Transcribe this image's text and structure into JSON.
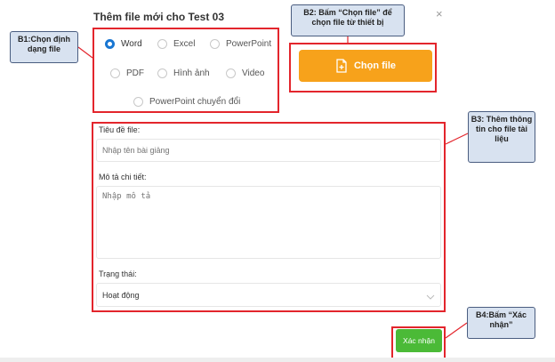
{
  "modal": {
    "title": "Thêm file mới cho Test 03",
    "close": "×"
  },
  "file_types": {
    "options": [
      {
        "label": "Word",
        "checked": true
      },
      {
        "label": "Excel",
        "checked": false
      },
      {
        "label": "PowerPoint",
        "checked": false
      },
      {
        "label": "PDF",
        "checked": false
      },
      {
        "label": "Hình ảnh",
        "checked": false
      },
      {
        "label": "Video",
        "checked": false
      },
      {
        "label": "PowerPoint chuyển đổi",
        "checked": false
      }
    ]
  },
  "upload": {
    "label": "Chọn file",
    "icon": "file-add-icon",
    "color": "#f7a21b"
  },
  "form": {
    "title_label": "Tiêu đề file:",
    "title_placeholder": "Nhập tên bài giảng",
    "desc_label": "Mô tả chi tiết:",
    "desc_placeholder": "Nhập mô tả",
    "status_label": "Trạng thái:",
    "status_value": "Hoạt động"
  },
  "confirm": {
    "label": "Xác nhận",
    "color": "#4bba37"
  },
  "annotations": {
    "b1": "B1:Chọn định dạng file",
    "b2": "B2: Bấm “Chọn file” để chọn file từ thiết bị",
    "b3": "B3: Thêm thông tin cho file tài liệu",
    "b4": "B4:Bấm “Xác nhận”"
  },
  "colors": {
    "highlight": "#e3252c",
    "radio_selected": "#1976d2",
    "note_bg": "#d8e2f0"
  }
}
